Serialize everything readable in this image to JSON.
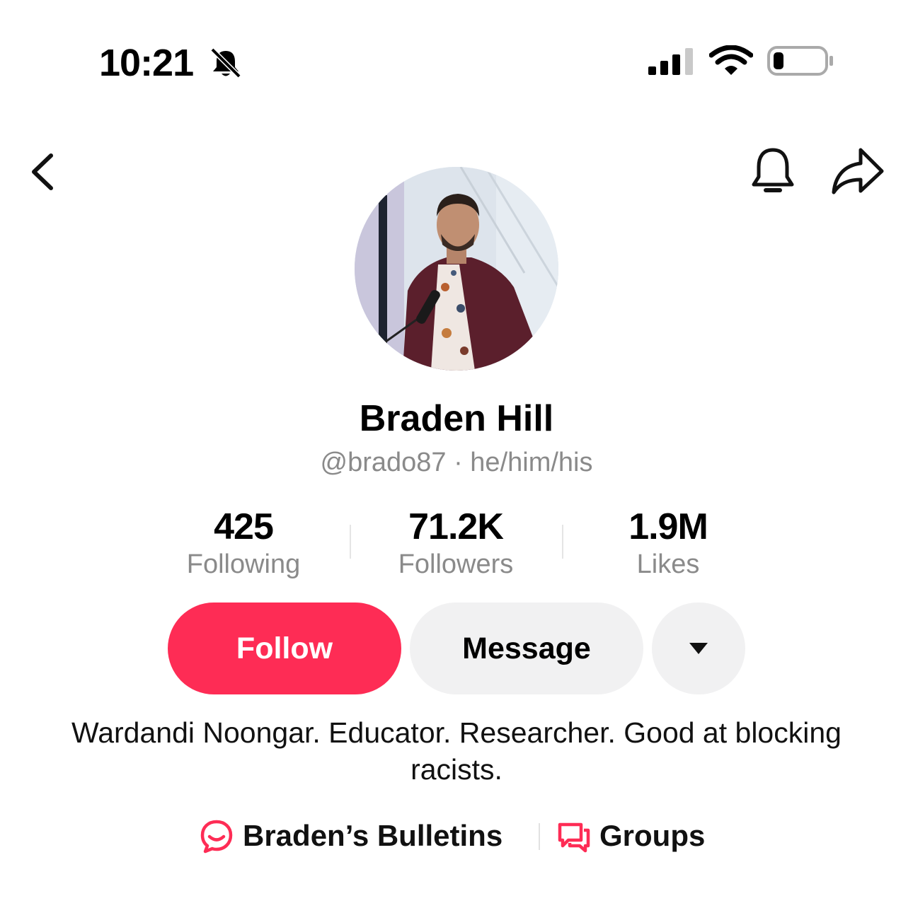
{
  "status_bar": {
    "time": "10:21",
    "icons": [
      "bell-slash-icon",
      "cellular-signal-icon",
      "wifi-icon",
      "battery-low-icon"
    ]
  },
  "nav": {
    "back_icon": "chevron-left-icon",
    "notification_icon": "bell-icon",
    "share_icon": "share-arrow-icon"
  },
  "profile": {
    "name": "Braden Hill",
    "handle_line": "@brado87 · he/him/his",
    "avatar_icon": "profile-photo"
  },
  "stats": [
    {
      "value": "425",
      "label": "Following"
    },
    {
      "value": "71.2K",
      "label": "Followers"
    },
    {
      "value": "1.9M",
      "label": "Likes"
    }
  ],
  "actions": {
    "follow_label": "Follow",
    "message_label": "Message",
    "more_icon": "caret-down-icon"
  },
  "bio": "Wardandi Noongar. Educator. Researcher. Good at blocking racists.",
  "links": [
    {
      "label": "Braden’s Bulletins",
      "icon": "chat-bubble-icon"
    },
    {
      "label": "Groups",
      "icon": "group-chat-icon"
    }
  ],
  "colors": {
    "accent": "#fe2c55",
    "secondary_button": "#f1f1f2",
    "muted_text": "#8a8a8a"
  }
}
